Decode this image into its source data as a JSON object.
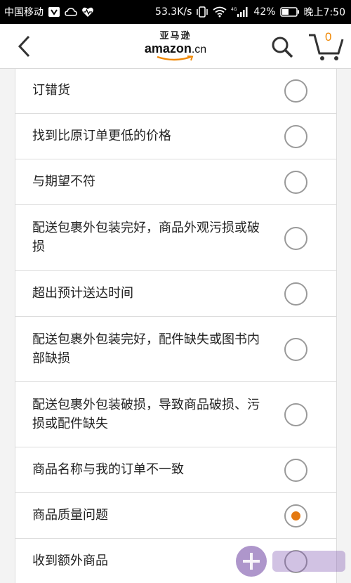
{
  "status_bar": {
    "carrier": "中国移动",
    "speed": "53.3K/s",
    "network": "4G",
    "battery": "42%",
    "time": "晚上7:50",
    "icons": [
      "sim-icon",
      "weather-icon",
      "health-icon",
      "vibrate-icon",
      "wifi-icon",
      "signal-icon",
      "battery-icon"
    ]
  },
  "header": {
    "logo_cn": "亚马逊",
    "logo_en": "amazon",
    "logo_suffix": ".cn",
    "cart_count": "0",
    "accent_color": "#f08804"
  },
  "reasons": [
    {
      "label": "订错货",
      "selected": false
    },
    {
      "label": "找到比原订单更低的价格",
      "selected": false
    },
    {
      "label": "与期望不符",
      "selected": false
    },
    {
      "label": "配送包裹外包装完好，商品外观污损或破损",
      "selected": false
    },
    {
      "label": "超出预计送达时间",
      "selected": false
    },
    {
      "label": "配送包裹外包装完好，配件缺失或图书内部缺损",
      "selected": false
    },
    {
      "label": "配送包裹外包装破损，导致商品破损、污损或配件缺失",
      "selected": false
    },
    {
      "label": "商品名称与我的订单不一致",
      "selected": false
    },
    {
      "label": "商品质量问题",
      "selected": true
    },
    {
      "label": "收到额外商品",
      "selected": false
    }
  ]
}
